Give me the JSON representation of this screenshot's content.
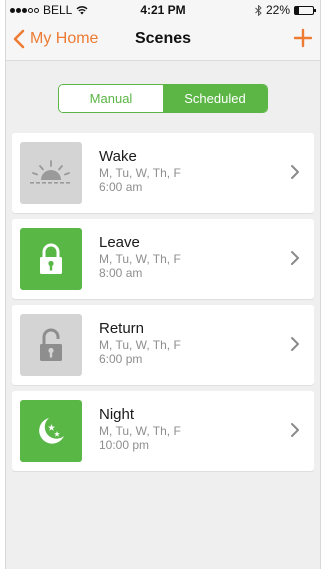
{
  "status_bar": {
    "carrier": "BELL",
    "time": "4:21 PM",
    "battery_percent": "22%",
    "battery_level": 0.22,
    "icons": [
      "signal-dots",
      "wifi-icon",
      "bluetooth-icon",
      "battery-icon"
    ]
  },
  "nav": {
    "back_label": "My Home",
    "title": "Scenes",
    "add_icon": "plus-icon",
    "accent": "#ee7b34"
  },
  "segment": {
    "manual_label": "Manual",
    "scheduled_label": "Scheduled",
    "selected": "Scheduled",
    "color": "#5cb646"
  },
  "scenes": [
    {
      "name": "Wake",
      "days": "M, Tu, W, Th, F",
      "time": "6:00 am",
      "icon": "sunrise-icon",
      "icon_style": "gray"
    },
    {
      "name": "Leave",
      "days": "M, Tu, W, Th, F",
      "time": "8:00 am",
      "icon": "lock-closed-icon",
      "icon_style": "green"
    },
    {
      "name": "Return",
      "days": "M, Tu, W, Th, F",
      "time": "6:00 pm",
      "icon": "lock-open-icon",
      "icon_style": "gray"
    },
    {
      "name": "Night",
      "days": "M, Tu, W, Th, F",
      "time": "10:00 pm",
      "icon": "moon-stars-icon",
      "icon_style": "green"
    }
  ]
}
